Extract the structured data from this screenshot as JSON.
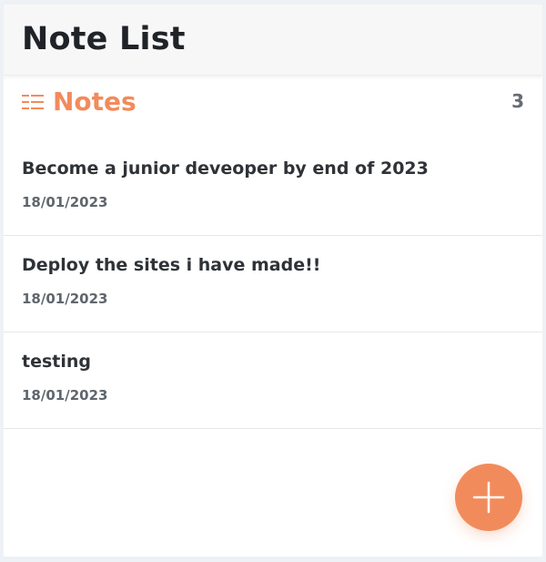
{
  "header": {
    "title": "Note List"
  },
  "notes_section": {
    "icon": "list-icon",
    "title": "Notes",
    "count": "3",
    "accent": "#f28b5b",
    "items": [
      {
        "title": "Become a junior deveoper by end of 2023",
        "date": "18/01/2023"
      },
      {
        "title": "Deploy the sites i have made!!",
        "date": "18/01/2023"
      },
      {
        "title": "testing",
        "date": "18/01/2023"
      }
    ]
  },
  "fab": {
    "icon": "plus-icon"
  }
}
